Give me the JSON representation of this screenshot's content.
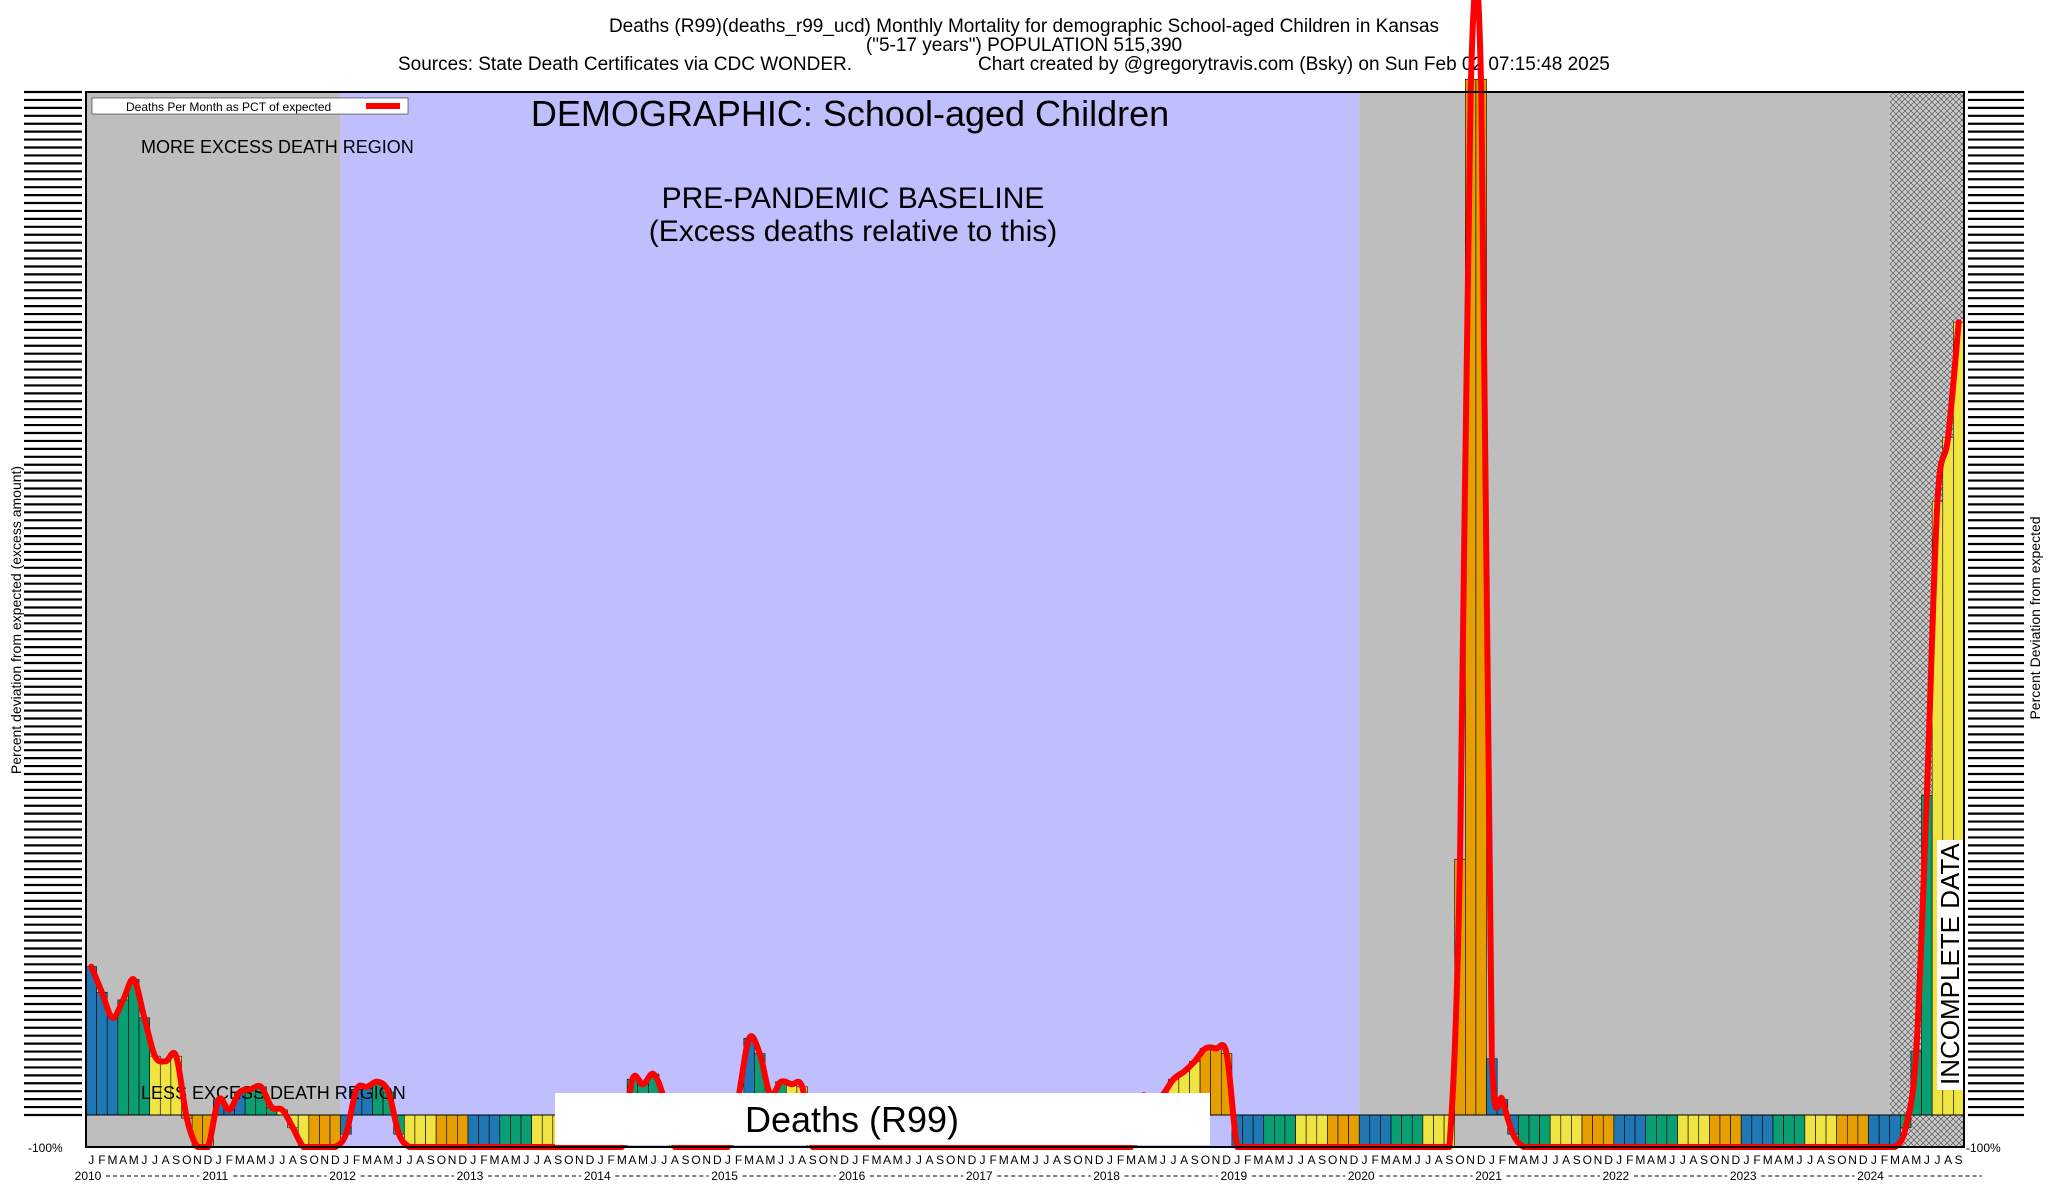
{
  "header": {
    "title": "Deaths (R99)(deaths_r99_ucd) Monthly Mortality for demographic School-aged Children in Kansas",
    "subtitle": "(\"5-17 years\") POPULATION 515,390",
    "sources": "Sources: State Death Certificates via CDC WONDER.",
    "credit": "Chart created by @gregorytravis.com (Bsky) on Sun Feb 02 07:15:48 2025"
  },
  "labels": {
    "demographic": "DEMOGRAPHIC: School-aged Children",
    "baseline_line1": "PRE-PANDEMIC BASELINE",
    "baseline_line2": "(Excess deaths relative to this)",
    "more_excess": "MORE EXCESS DEATH REGION",
    "less_excess": "LESS EXCESS DEATH REGION",
    "cause_box": "Deaths (R99)",
    "incomplete": "INCOMPLETE DATA"
  },
  "chart_data": {
    "type": "bar",
    "title": "Deaths (R99)(deaths_r99_ucd) Monthly Mortality for demographic School-aged Children in Kansas",
    "xlabel": "",
    "ylabel": "Percent deviation from expected (excess amount)",
    "ylabel_right": "Percent Deviation from expected",
    "ylim": [
      -100,
      4000
    ],
    "bottom_tick_label": "-100%",
    "legend": {
      "label": "Deaths Per Month as PCT of expected",
      "color": "#ff0000",
      "placement": "top-left"
    },
    "month_letters": [
      "J",
      "F",
      "M",
      "A",
      "M",
      "J",
      "J",
      "A",
      "S",
      "O",
      "N",
      "D"
    ],
    "years": [
      "2010",
      "2011",
      "2012",
      "2013",
      "2014",
      "2015",
      "2016",
      "2017",
      "2018",
      "2019",
      "2020",
      "2021",
      "2022",
      "2023",
      "2024"
    ],
    "last_month_index": 176,
    "season_colors": [
      "#1f77b4",
      "#0a9e72",
      "#f0e442",
      "#e69f00"
    ],
    "line_color": "#ff0000",
    "regions": [
      {
        "name": "more-excess-region",
        "start_month": 0,
        "end_month": 24,
        "color": "#bebebe"
      },
      {
        "name": "baseline-region",
        "start_month": 24,
        "end_month": 120,
        "color": "#bfbffe"
      },
      {
        "name": "post-baseline-region",
        "start_month": 120,
        "end_month": 170,
        "color": "#bebebe"
      },
      {
        "name": "incomplete-region",
        "start_month": 170,
        "end_month": 177,
        "color": "#c8c8c8"
      }
    ],
    "values": [
      580,
      480,
      380,
      450,
      530,
      380,
      230,
      210,
      230,
      -10,
      -100,
      -100,
      60,
      20,
      90,
      100,
      110,
      30,
      20,
      -40,
      -100,
      -100,
      -100,
      -100,
      -60,
      100,
      110,
      130,
      90,
      -60,
      -100,
      -100,
      -100,
      -100,
      -100,
      -100,
      -100,
      -100,
      -100,
      -100,
      -100,
      -100,
      -100,
      -100,
      -100,
      -100,
      -100,
      -100,
      -100,
      -100,
      -100,
      140,
      120,
      160,
      60,
      -100,
      -100,
      -100,
      -100,
      -100,
      -100,
      70,
      300,
      240,
      80,
      130,
      120,
      110,
      -100,
      -100,
      -100,
      -100,
      -100,
      -100,
      -100,
      -100,
      -100,
      -100,
      -100,
      -100,
      -100,
      -100,
      -100,
      -100,
      -100,
      -100,
      -100,
      -100,
      -100,
      -100,
      -100,
      -100,
      -100,
      -100,
      -100,
      -100,
      -100,
      -100,
      -100,
      70,
      40,
      80,
      140,
      170,
      210,
      260,
      260,
      240,
      -100,
      -100,
      -100,
      -100,
      -100,
      -100,
      -100,
      -100,
      -100,
      -100,
      -100,
      -100,
      -100,
      -100,
      -100,
      -100,
      -100,
      -100,
      -100,
      -100,
      -100,
      1000,
      4050,
      4050,
      220,
      60,
      -60,
      -100,
      -100,
      -100,
      -100,
      -100,
      -100,
      -100,
      -100,
      -100,
      -100,
      -100,
      -100,
      -100,
      -100,
      -100,
      -100,
      -100,
      -100,
      -100,
      -100,
      -100,
      -100,
      -100,
      -100,
      -100,
      -100,
      -100,
      -100,
      -100,
      -100,
      -100,
      -100,
      -100,
      -100,
      -100,
      -100,
      -40,
      250,
      1250,
      2400,
      2650,
      3100
    ]
  }
}
